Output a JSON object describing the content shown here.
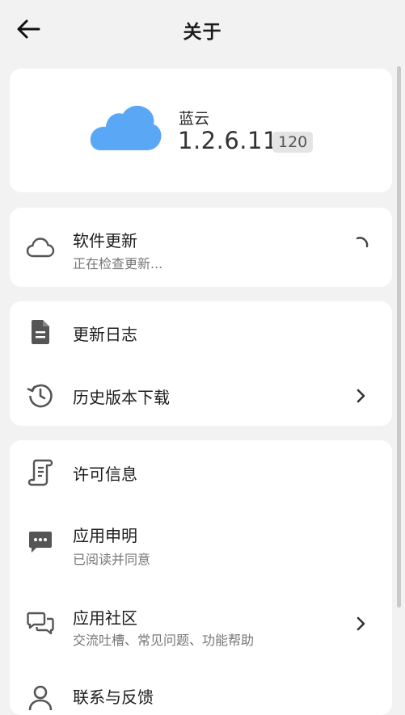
{
  "header": {
    "title": "关于",
    "back_icon": "arrow-left-icon"
  },
  "app": {
    "name": "蓝云",
    "version": "1.2.6.11",
    "build": "120",
    "logo_icon": "cloud-logo-icon",
    "logo_color": "#5aa8f5"
  },
  "update": {
    "title": "软件更新",
    "status": "正在检查更新...",
    "icon": "cloud-icon",
    "loading_icon": "spinner-icon"
  },
  "log_section": {
    "items": [
      {
        "label": "更新日志",
        "icon": "document-icon"
      },
      {
        "label": "历史版本下载",
        "icon": "history-icon",
        "has_arrow": true
      }
    ]
  },
  "info_section": {
    "items": [
      {
        "label": "许可信息",
        "icon": "scroll-icon"
      },
      {
        "label": "应用申明",
        "sub": "已阅读并同意",
        "icon": "message-dots-icon"
      },
      {
        "label": "应用社区",
        "sub": "交流吐槽、常见问题、功能帮助",
        "icon": "chat-bubbles-icon",
        "has_arrow": true
      },
      {
        "label": "联系与反馈",
        "icon": "person-icon"
      }
    ]
  }
}
